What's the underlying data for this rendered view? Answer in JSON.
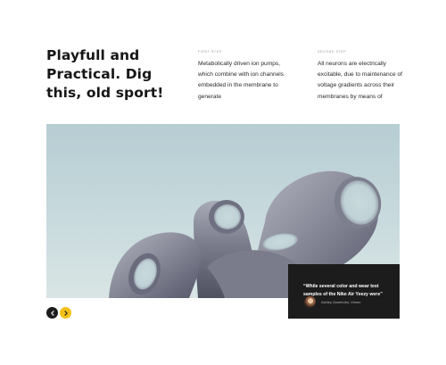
{
  "headline": "Playfull and Practical. Dig this, old sport!",
  "steps": [
    {
      "label": "FIRST STEP",
      "text": "Metabolically driven ion pumps, which combine with ion channels embedded in the membrane to generate"
    },
    {
      "label": "SECOND STEP",
      "text": "All neurons are electrically excitable, due to maintenance of voltage gradients across their membranes by means of"
    }
  ],
  "testimonial": {
    "quote": "“While several color and wear test samples of the Nike Air Yeezy were”",
    "author": "Ashley Zaneforks, Vimeo"
  },
  "icons": {
    "prev": "chevron-left-icon",
    "next": "chevron-right-icon"
  },
  "colors": {
    "accent": "#f2c21a",
    "dark": "#1c1c1c",
    "text": "#161616"
  }
}
